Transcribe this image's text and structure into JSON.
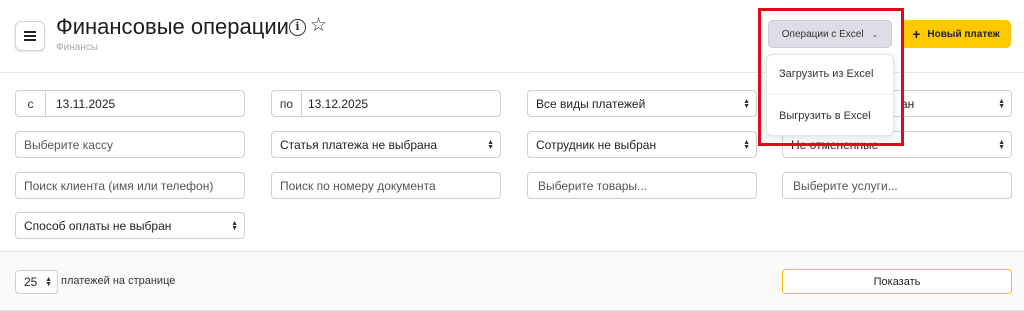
{
  "header": {
    "title": "Финансовые операции",
    "breadcrumb": "Финансы",
    "excel_button_label": "Операции с Excel",
    "new_payment_label": "Новый платеж",
    "excel_menu": [
      "Загрузить из Excel",
      "Выгрузить в Excel"
    ]
  },
  "filters": {
    "date_from_prefix": "с",
    "date_from": "13.11.2025",
    "date_to_prefix": "по",
    "date_to": "13.12.2025",
    "payment_types": "Все виды платежей",
    "hidden_select_1_visible": "ан",
    "cashbox_placeholder": "Выберите кассу",
    "payment_item": "Статья платежа не выбрана",
    "employee": "Сотрудник не выбран",
    "hidden_select_2_visible": "Не отмененные",
    "client_search_placeholder": "Поиск клиента (имя или телефон)",
    "document_search_placeholder": "Поиск по номеру документа",
    "goods_placeholder": "Выберите товары...",
    "services_placeholder": "Выберите услуги...",
    "payment_method": "Способ оплаты не выбран"
  },
  "pagination": {
    "per_page": "25",
    "per_page_label": "платежей на странице",
    "show_label": "Показать"
  },
  "colors": {
    "accent_yellow": "#ffc900",
    "excel_button_bg": "#dcdde6",
    "highlight_red": "#e4071c"
  }
}
